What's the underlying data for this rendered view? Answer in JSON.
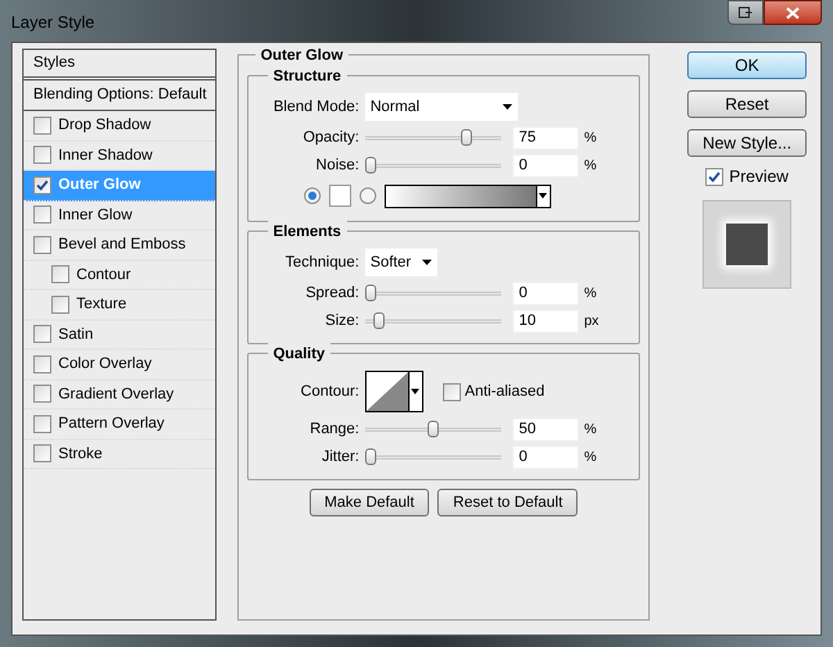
{
  "window": {
    "title": "Layer Style"
  },
  "styles": {
    "header": "Styles",
    "blending": "Blending Options: Default",
    "items": [
      {
        "label": "Drop Shadow",
        "checked": false,
        "selected": false
      },
      {
        "label": "Inner Shadow",
        "checked": false,
        "selected": false
      },
      {
        "label": "Outer Glow",
        "checked": true,
        "selected": true
      },
      {
        "label": "Inner Glow",
        "checked": false,
        "selected": false
      },
      {
        "label": "Bevel and Emboss",
        "checked": false,
        "selected": false,
        "children": [
          {
            "label": "Contour",
            "checked": false,
            "selected": false
          },
          {
            "label": "Texture",
            "checked": false,
            "selected": false
          }
        ]
      },
      {
        "label": "Satin",
        "checked": false,
        "selected": false
      },
      {
        "label": "Color Overlay",
        "checked": false,
        "selected": false
      },
      {
        "label": "Gradient Overlay",
        "checked": false,
        "selected": false
      },
      {
        "label": "Pattern Overlay",
        "checked": false,
        "selected": false
      },
      {
        "label": "Stroke",
        "checked": false,
        "selected": false
      }
    ]
  },
  "panel": {
    "title": "Outer Glow",
    "structure": {
      "title": "Structure",
      "blend_mode": {
        "label": "Blend Mode:",
        "value": "Normal"
      },
      "sliders": [
        {
          "label": "Opacity:",
          "value": "75",
          "unit": "%",
          "level": 0.75
        },
        {
          "label": "Noise:",
          "value": "0",
          "unit": "%",
          "level": 0
        }
      ],
      "fill": [
        {
          "kind": "color",
          "selected": true
        },
        {
          "kind": "gradient",
          "selected": false
        }
      ]
    },
    "elements": {
      "title": "Elements",
      "technique": {
        "label": "Technique:",
        "value": "Softer"
      },
      "sliders": [
        {
          "label": "Spread:",
          "value": "0",
          "unit": "%",
          "level": 0
        },
        {
          "label": "Size:",
          "value": "10",
          "unit": "px",
          "level": 0.1
        }
      ]
    },
    "quality": {
      "title": "Quality",
      "contour": {
        "label": "Contour:"
      },
      "anti_aliased": {
        "label": "Anti-aliased",
        "checked": false
      },
      "sliders": [
        {
          "label": "Range:",
          "value": "50",
          "unit": "%",
          "level": 0.5
        },
        {
          "label": "Jitter:",
          "value": "0",
          "unit": "%",
          "level": 0
        }
      ]
    },
    "buttons": [
      "Make Default",
      "Reset to Default"
    ]
  },
  "actions": [
    {
      "label": "OK",
      "default": true
    },
    {
      "label": "Reset",
      "default": false
    },
    {
      "label": "New Style...",
      "default": false
    }
  ],
  "preview": {
    "label": "Preview",
    "checked": true
  }
}
